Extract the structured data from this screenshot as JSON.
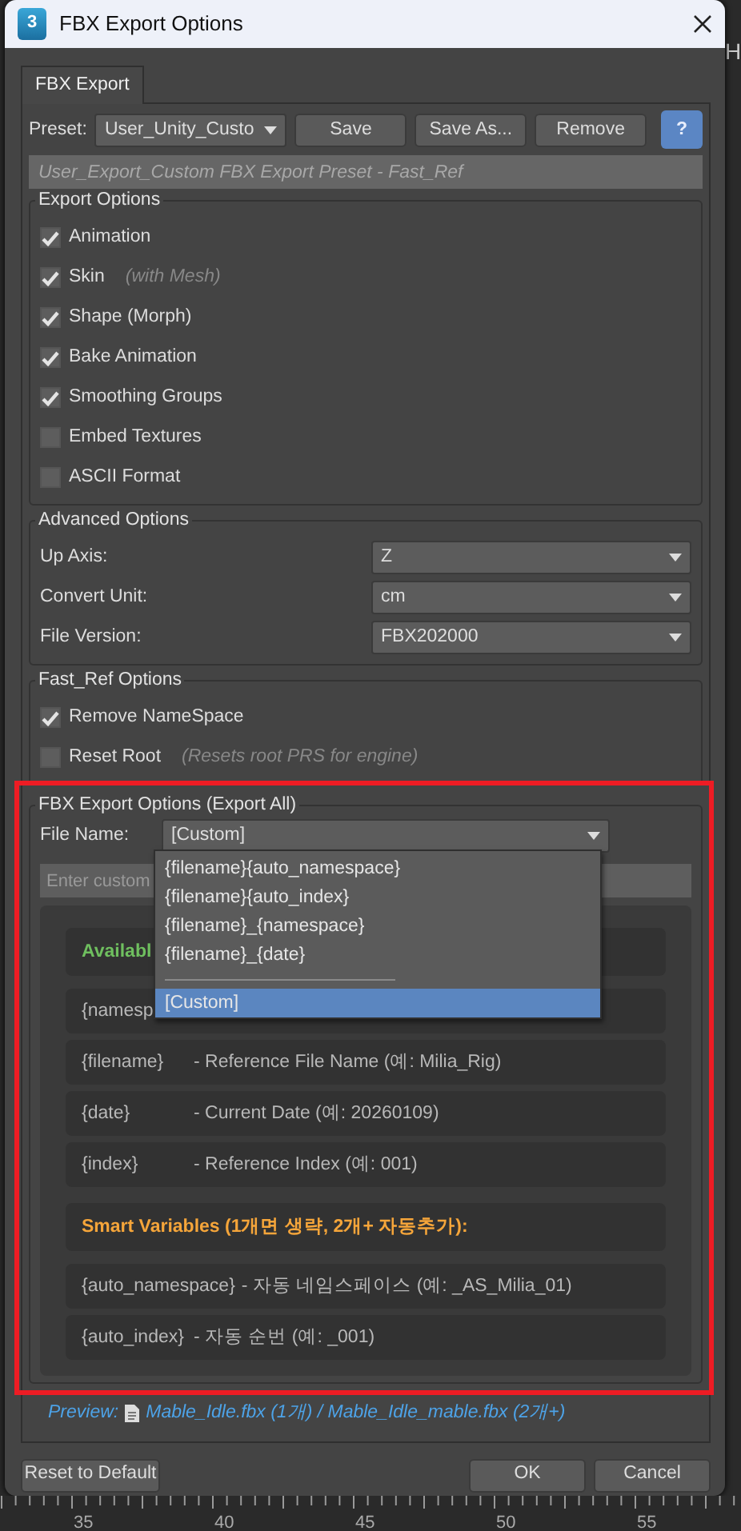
{
  "window": {
    "title": "FBX Export Options",
    "app_icon_text": "3"
  },
  "background": {
    "edge_text": "H",
    "ruler_labels": [
      "35",
      "40",
      "45",
      "50",
      "55"
    ]
  },
  "tabs": [
    {
      "label": "FBX Export",
      "selected": true
    }
  ],
  "preset": {
    "label": "Preset:",
    "value": "User_Unity_Custo",
    "buttons": [
      "Save",
      "Save As...",
      "Remove"
    ],
    "help_button": "?"
  },
  "description": {
    "placeholder": "User_Export_Custom FBX Export Preset - Fast_Ref"
  },
  "export_options": {
    "title": "Export Options",
    "items": [
      {
        "label": "Animation",
        "checked": true
      },
      {
        "label": "Skin",
        "note": "(with Mesh)",
        "checked": true
      },
      {
        "label": "Shape (Morph)",
        "checked": true
      },
      {
        "label": "Bake Animation",
        "checked": true
      },
      {
        "label": "Smoothing Groups",
        "checked": true
      },
      {
        "label": "Embed Textures",
        "checked": false
      },
      {
        "label": "ASCII Format",
        "checked": false
      }
    ]
  },
  "advanced_options": {
    "title": "Advanced Options",
    "fields": [
      {
        "label": "Up Axis:",
        "value": "Z"
      },
      {
        "label": "Convert Unit:",
        "value": "cm"
      },
      {
        "label": "File Version:",
        "value": "FBX202000"
      }
    ]
  },
  "fast_ref_options": {
    "title": "Fast_Ref Options",
    "items": [
      {
        "label": "Remove NameSpace",
        "checked": true
      },
      {
        "label": "Reset Root",
        "note": "(Resets root PRS for engine)",
        "checked": false
      }
    ]
  },
  "export_all": {
    "title": "FBX Export Options (Export All)",
    "highlighted": true,
    "file_name": {
      "label": "File Name:",
      "value": "[Custom]",
      "expanded": true,
      "options": [
        {
          "label": "{filename}{auto_namespace}",
          "selected": false
        },
        {
          "label": "{filename}{auto_index}",
          "selected": false
        },
        {
          "label": "{filename}_{namespace}",
          "selected": false
        },
        {
          "label": "{filename}_{date}",
          "selected": false
        },
        {
          "kind": "separator"
        },
        {
          "label": "[Custom]",
          "selected": true
        }
      ]
    },
    "custom_field": {
      "placeholder": "Enter custom"
    },
    "help_rows": [
      {
        "kind": "header",
        "text": "Availabl",
        "color": "#6fbf5f"
      },
      {
        "kind": "item",
        "variable": "{namesp"
      },
      {
        "kind": "item",
        "variable": "{filename}",
        "description": "- Reference File Name (예: Milia_Rig)"
      },
      {
        "kind": "item",
        "variable": "{date}",
        "description": "- Current Date (예: 20260109)"
      },
      {
        "kind": "item",
        "variable": "{index}",
        "description": "- Reference Index (예: 001)"
      },
      {
        "kind": "header",
        "text": "Smart Variables (1개면 생략, 2개+ 자동추가):",
        "color": "#f5a53a"
      },
      {
        "kind": "item",
        "variable": "{auto_namespace}",
        "description": "- 자동 네임스페이스 (예: _AS_Milia_01)"
      },
      {
        "kind": "item",
        "variable": "{auto_index}",
        "description": "- 자동 순번 (예: _001)"
      }
    ]
  },
  "preview": {
    "label": "Preview:",
    "text": "Mable_Idle.fbx (1개) / Mable_Idle_mable.fbx (2개+)"
  },
  "footer": {
    "reset": "Reset to Default",
    "ok": "OK",
    "cancel": "Cancel"
  }
}
